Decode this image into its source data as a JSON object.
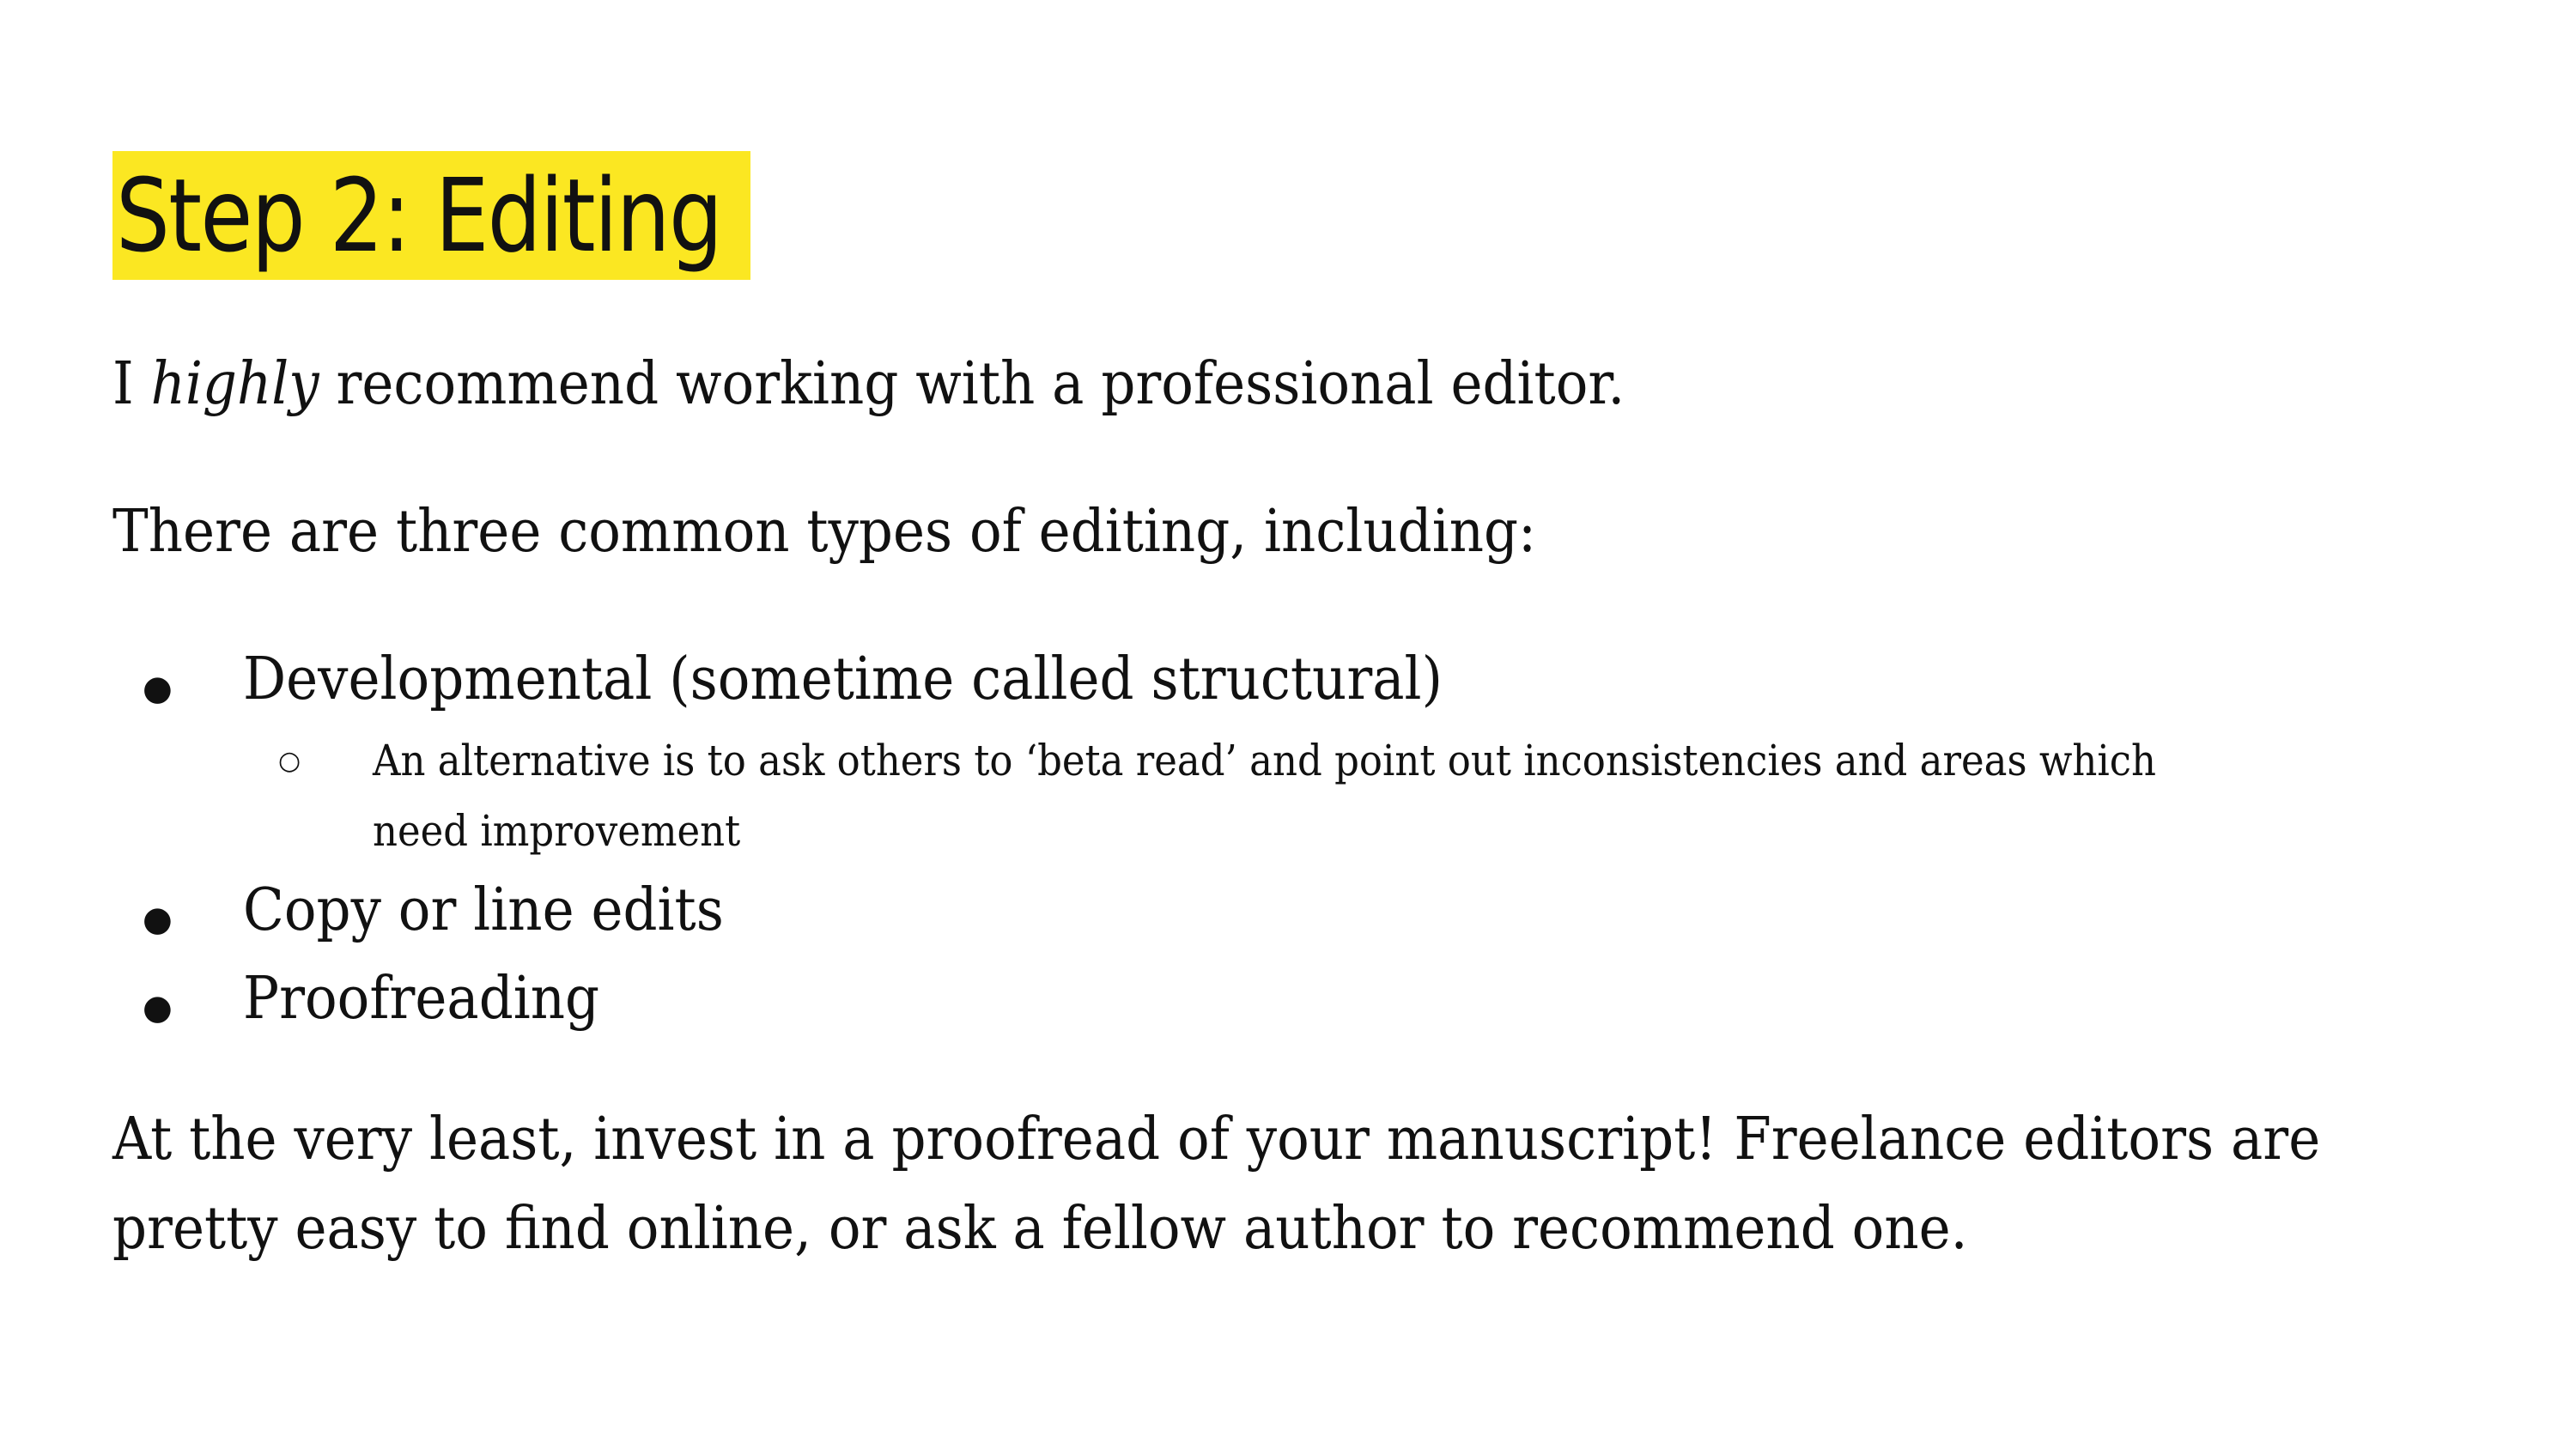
{
  "title": "Step 2: Editing",
  "intro": {
    "pre": "I ",
    "emphasis": "highly",
    "post": " recommend working with a professional editor."
  },
  "lead": "There are three common types of editing, including:",
  "bullets": {
    "symbol": "●",
    "sub_symbol": "○",
    "item1": "Developmental (sometime called structural)",
    "item1_sub1_line1": "An alternative is to ask others to ‘beta read’ and point out inconsistencies and areas which",
    "item1_sub1_line2": "need improvement",
    "item2": "Copy or line edits",
    "item3": "Proofreading"
  },
  "closing": {
    "line1": "At the very least, invest in a proofread of your manuscript! Freelance editors are",
    "line2": "pretty easy to find online, or ask a fellow author to recommend one."
  },
  "colors": {
    "highlight": "#fbe722",
    "text": "#111111",
    "background": "#ffffff"
  }
}
